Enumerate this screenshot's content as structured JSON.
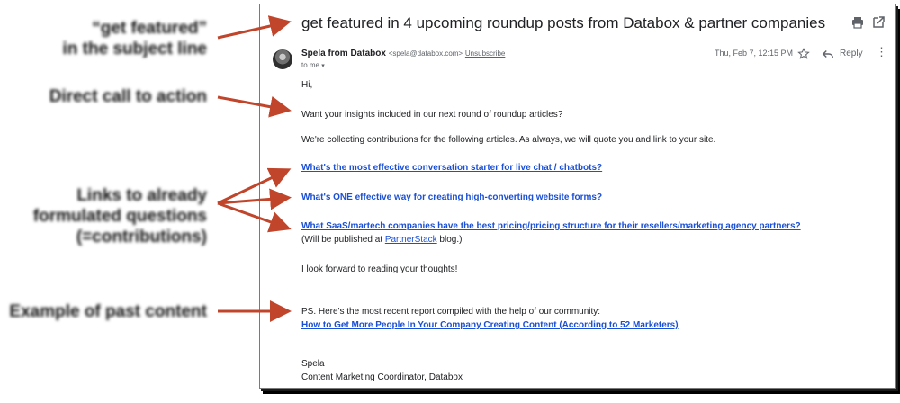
{
  "annotations": [
    [
      "“get featured”",
      "in the subject line"
    ],
    [
      "Direct call to action"
    ],
    [
      "Links to already",
      "formulated questions",
      "(=contributions)"
    ],
    [
      "Example of past content"
    ]
  ],
  "email": {
    "subject": "get featured in 4 upcoming roundup posts from Databox & partner companies",
    "sender_name": "Spela from Databox",
    "sender_email": "<spela@databox.com>",
    "unsubscribe": "Unsubscribe",
    "to_me": "to me",
    "date": "Thu, Feb 7, 12:15 PM",
    "reply_label": "Reply",
    "greeting": "Hi,",
    "intro": "Want your insights included in our next round of roundup articles?",
    "collecting": "We're collecting contributions for the following articles. As always, we will quote you and link to your site.",
    "questions": [
      "What's the most effective conversation starter for live chat / chatbots?",
      "What's ONE effective way for creating high-converting website forms?",
      "What SaaS/martech companies have the best pricing/pricing structure for their resellers/marketing agency partners?"
    ],
    "published_prefix": "(Will be published at ",
    "published_link": "PartnerStack",
    "published_suffix": " blog.)",
    "forward": "I look forward to reading your thoughts!",
    "ps": "PS. Here's the most recent report compiled with the help of our community:",
    "report_link": "How to Get More People In Your Company Creating Content (According to 52 Marketers)",
    "sign_name": "Spela",
    "sign_title": "Content Marketing Coordinator, Databox"
  },
  "icons": {
    "print": "print-icon",
    "open_new_window": "open-in-new-window-icon",
    "avatar": "avatar",
    "star": "star-icon",
    "reply": "reply-icon",
    "more": "more-options-icon",
    "dropdown": "chevron-down-icon"
  },
  "colors": {
    "arrow": "#c0452b",
    "link": "#1a4fd6",
    "text": "#202124",
    "muted": "#5f6368"
  }
}
